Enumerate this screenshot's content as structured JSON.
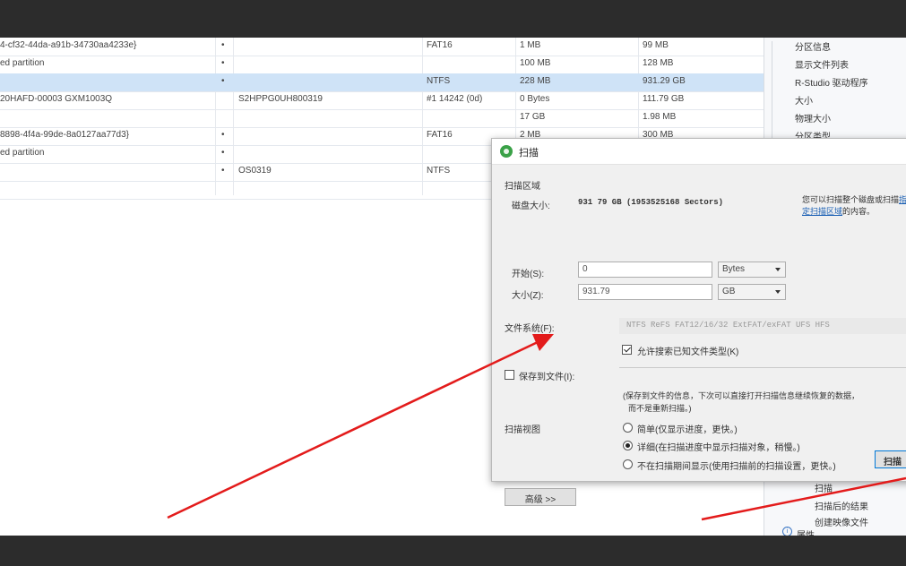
{
  "table": {
    "rows": [
      {
        "name": "4-cf32-44da-a91b-34730aa4233e}",
        "mark": "•",
        "label": "",
        "fs": "FAT16",
        "size": "1 MB",
        "free": "99 MB",
        "selected": false
      },
      {
        "name": "ed partition",
        "mark": "•",
        "label": "",
        "fs": "",
        "size": "100 MB",
        "free": "128 MB",
        "selected": false
      },
      {
        "name": "",
        "mark": "•",
        "label": "",
        "fs": "NTFS",
        "size": "228 MB",
        "free": "931.29 GB",
        "selected": true
      },
      {
        "name": "20HAFD-00003 GXM1003Q",
        "mark": "",
        "label": "S2HPPG0UH800319",
        "fs": "#1 14242 (0d)",
        "size": "0 Bytes",
        "free": "111.79 GB",
        "selected": false
      },
      {
        "name": "",
        "mark": "",
        "label": "",
        "fs": "",
        "size": "17 GB",
        "free": "1.98 MB",
        "selected": false
      },
      {
        "name": "8898-4f4a-99de-8a0127aa77d3}",
        "mark": "•",
        "label": "",
        "fs": "FAT16",
        "size": "2 MB",
        "free": "300 MB",
        "selected": false
      },
      {
        "name": "ed partition",
        "mark": "•",
        "label": "",
        "fs": "",
        "size": "",
        "free": "",
        "selected": false
      },
      {
        "name": "",
        "mark": "•",
        "label": "OS0319",
        "fs": "NTFS",
        "size": "",
        "free": "",
        "selected": false
      }
    ]
  },
  "right_panel": {
    "items": [
      "分区信息",
      "显示文件列表",
      "R-Studio 驱动程序",
      "大小",
      "物理大小",
      "分区类型",
      "扫描",
      "扫描后的结果",
      "创建映像文件",
      "属性"
    ]
  },
  "dialog": {
    "title": "扫描",
    "group_title": "扫描区域",
    "disk_size_label": "磁盘大小:",
    "disk_size_value": "931 79 GB (1953525168 Sectors)",
    "hint_text": "您可以扫描整个磁盘或扫描",
    "hint_link": "指定扫描区域",
    "hint_suffix": "的内容。",
    "start_label": "开始(S):",
    "start_value": "0",
    "start_unit": "Bytes",
    "size_label": "大小(Z):",
    "size_value": "931.79",
    "size_unit": "GB",
    "fs_label": "文件系统(F):",
    "fs_list": "NTFS  ReFS  FAT12/16/32  ExtFAT/exFAT  UFS  HFS",
    "known_files_label": "允许搜索已知文件类型(K)",
    "save_checkbox_label": "保存到文件(I):",
    "info_line1": "(保存到文件的信息，下次可以直接打开扫描信息继续恢复的数据，",
    "info_line2": "而不是重新扫描。)",
    "view_label": "扫描视图",
    "view_options": [
      "简单(仅显示进度，更快。)",
      "详细(在扫描进度中显示扫描对象，稍慢。)",
      "不在扫描期间显示(使用扫描前的扫描设置，更快。)"
    ],
    "advanced_button": "高级 >>",
    "scan_button": "扫描"
  }
}
